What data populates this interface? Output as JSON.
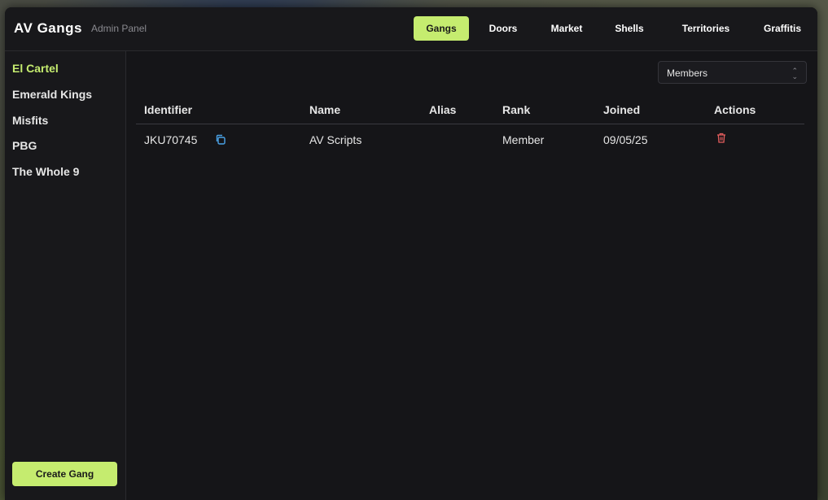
{
  "header": {
    "title": "AV Gangs",
    "subtitle": "Admin Panel",
    "tabs": [
      {
        "label": "Gangs",
        "active": true
      },
      {
        "label": "Doors",
        "active": false
      },
      {
        "label": "Market",
        "active": false
      },
      {
        "label": "Shells",
        "active": false
      },
      {
        "label": "Territories",
        "active": false
      },
      {
        "label": "Graffitis",
        "active": false
      }
    ]
  },
  "sidebar": {
    "items": [
      {
        "label": "El Cartel",
        "active": true
      },
      {
        "label": "Emerald Kings",
        "active": false
      },
      {
        "label": "Misfits",
        "active": false
      },
      {
        "label": "PBG",
        "active": false
      },
      {
        "label": "The Whole 9",
        "active": false
      }
    ],
    "create_label": "Create Gang"
  },
  "main": {
    "view_select": {
      "value": "Members"
    },
    "table": {
      "headers": [
        "Identifier",
        "Name",
        "Alias",
        "Rank",
        "Joined",
        "Actions"
      ],
      "rows": [
        {
          "identifier": "JKU70745",
          "name": "AV Scripts",
          "alias": "",
          "rank": "Member",
          "joined": "09/05/25"
        }
      ]
    }
  },
  "colors": {
    "accent": "#c5ec6f",
    "panel_bg": "#151518",
    "copy_icon": "#4aa3e8",
    "delete_icon": "#e35d5d"
  },
  "icons": {
    "copy": "copy-icon",
    "delete": "trash-icon",
    "select_chevron": "chevron-updown-icon"
  }
}
